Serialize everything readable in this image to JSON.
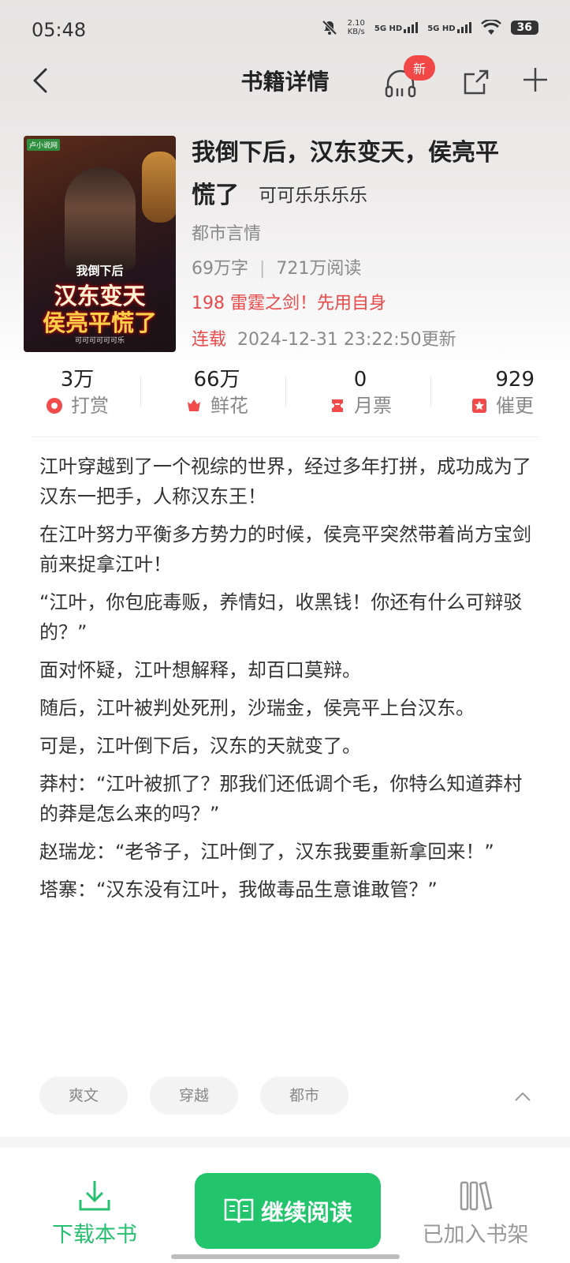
{
  "status_bar": {
    "time": "05:48",
    "speed_value": "2.10",
    "speed_unit": "KB/s",
    "network1": "5G HD",
    "network2": "5G HD",
    "battery": "36"
  },
  "nav": {
    "title": "书籍详情",
    "new_badge": "新"
  },
  "book": {
    "title_line1": "我倒下后，汉东变天，侯亮平",
    "title_line2": "慌了",
    "author": "可可乐乐乐乐",
    "category": "都市言情",
    "word_count": "69万字",
    "stats_separator": "|",
    "reads": "721万阅读",
    "latest_chapter": "198 雷霆之剑！先用自身",
    "status": "连载",
    "updated": "2024-12-31 23:22:50更新",
    "cover": {
      "site": "卢小说网",
      "title_small": "我倒下后",
      "title_big1": "汉东变天",
      "title_big2": "侯亮平慌了",
      "author": "可可可可可可乐"
    }
  },
  "metrics": [
    {
      "value": "3万",
      "label": "打赏",
      "icon": "reward-icon"
    },
    {
      "value": "66万",
      "label": "鲜花",
      "icon": "flower-icon"
    },
    {
      "value": "0",
      "label": "月票",
      "icon": "ticket-icon"
    },
    {
      "value": "929",
      "label": "催更",
      "icon": "urge-icon"
    }
  ],
  "description": [
    "江叶穿越到了一个视综的世界，经过多年打拼，成功成为了汉东一把手，人称汉东王！",
    "在江叶努力平衡多方势力的时候，侯亮平突然带着尚方宝剑前来捉拿江叶！",
    "“江叶，你包庇毒贩，养情妇，收黑钱！你还有什么可辩驳的？”",
    "面对怀疑，江叶想解释，却百口莫辩。",
    "随后，江叶被判处死刑，沙瑞金，侯亮平上台汉东。",
    "可是，江叶倒下后，汉东的天就变了。",
    "莽村：“江叶被抓了？那我们还低调个毛，你特么知道莽村的莽是怎么来的吗？”",
    "赵瑞龙：“老爷子，江叶倒了，汉东我要重新拿回来！”",
    "塔寨：“汉东没有江叶，我做毒品生意谁敢管？”"
  ],
  "tags": [
    "爽文",
    "穿越",
    "都市"
  ],
  "bottom": {
    "download": "下载本书",
    "continue": "继续阅读",
    "shelf": "已加入书架"
  },
  "colors": {
    "accent_green": "#22c56c",
    "accent_red": "#e84a4a",
    "badge_red": "#f24747"
  }
}
